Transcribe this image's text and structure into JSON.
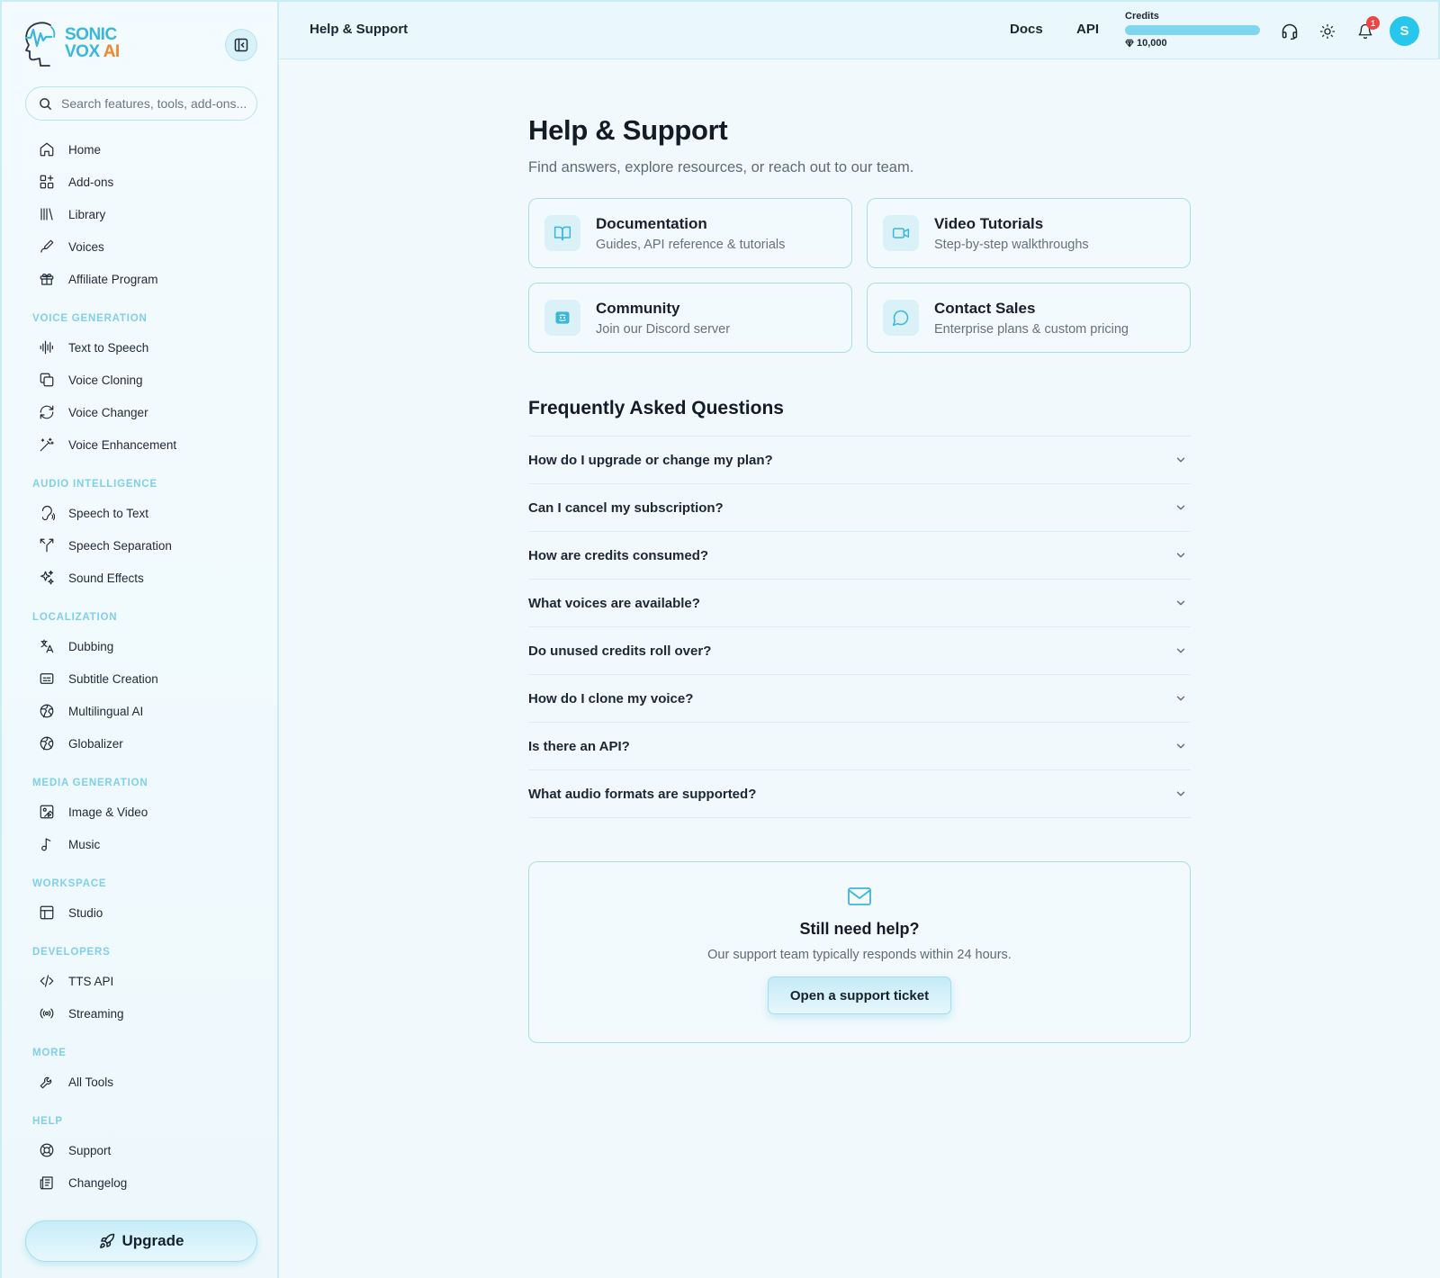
{
  "brand": {
    "line1": "SONIC",
    "line2_a": "VOX",
    "line2_b": "AI"
  },
  "search": {
    "placeholder": "Search features, tools, add-ons..."
  },
  "sidebar": {
    "top_items": [
      {
        "label": "Home",
        "icon": "home-icon"
      },
      {
        "label": "Add-ons",
        "icon": "addons-icon"
      },
      {
        "label": "Library",
        "icon": "library-icon"
      },
      {
        "label": "Voices",
        "icon": "voices-icon"
      },
      {
        "label": "Affiliate Program",
        "icon": "gift-icon"
      }
    ],
    "sections": [
      {
        "title": "VOICE GENERATION",
        "items": [
          {
            "label": "Text to Speech",
            "icon": "waveform-icon"
          },
          {
            "label": "Voice Cloning",
            "icon": "copy-icon"
          },
          {
            "label": "Voice Changer",
            "icon": "refresh-icon"
          },
          {
            "label": "Voice Enhancement",
            "icon": "magic-wand-icon"
          }
        ]
      },
      {
        "title": "AUDIO INTELLIGENCE",
        "items": [
          {
            "label": "Speech to Text",
            "icon": "ear-icon"
          },
          {
            "label": "Speech Separation",
            "icon": "split-icon"
          },
          {
            "label": "Sound Effects",
            "icon": "sparkles-icon"
          }
        ]
      },
      {
        "title": "LOCALIZATION",
        "items": [
          {
            "label": "Dubbing",
            "icon": "translate-icon"
          },
          {
            "label": "Subtitle Creation",
            "icon": "captions-icon"
          },
          {
            "label": "Multilingual AI",
            "icon": "globe-icon"
          },
          {
            "label": "Globalizer",
            "icon": "globe-icon"
          }
        ]
      },
      {
        "title": "MEDIA GENERATION",
        "items": [
          {
            "label": "Image & Video",
            "icon": "image-video-icon"
          },
          {
            "label": "Music",
            "icon": "music-note-icon"
          }
        ]
      },
      {
        "title": "WORKSPACE",
        "items": [
          {
            "label": "Studio",
            "icon": "layout-icon"
          }
        ]
      },
      {
        "title": "DEVELOPERS",
        "items": [
          {
            "label": "TTS API",
            "icon": "code-icon"
          },
          {
            "label": "Streaming",
            "icon": "broadcast-icon"
          }
        ]
      },
      {
        "title": "MORE",
        "items": [
          {
            "label": "All Tools",
            "icon": "wrench-icon"
          }
        ]
      },
      {
        "title": "HELP",
        "items": [
          {
            "label": "Support",
            "icon": "lifebuoy-icon"
          },
          {
            "label": "Changelog",
            "icon": "newspaper-icon"
          }
        ]
      }
    ],
    "upgrade_label": "Upgrade"
  },
  "header": {
    "title": "Help & Support",
    "docs_label": "Docs",
    "api_label": "API",
    "credits_label": "Credits",
    "credits_amount": "10,000",
    "credits_fill_percent": 100,
    "notification_count": "1",
    "avatar_initial": "S"
  },
  "main": {
    "title": "Help & Support",
    "subtitle": "Find answers, explore resources, or reach out to our team.",
    "cards": [
      {
        "title": "Documentation",
        "desc": "Guides, API reference & tutorials",
        "icon": "book-icon"
      },
      {
        "title": "Video Tutorials",
        "desc": "Step-by-step walkthroughs",
        "icon": "video-icon"
      },
      {
        "title": "Community",
        "desc": "Join our Discord server",
        "icon": "discord-icon"
      },
      {
        "title": "Contact Sales",
        "desc": "Enterprise plans & custom pricing",
        "icon": "chat-icon"
      }
    ],
    "faq_title": "Frequently Asked Questions",
    "faqs": [
      "How do I upgrade or change my plan?",
      "Can I cancel my subscription?",
      "How are credits consumed?",
      "What voices are available?",
      "Do unused credits roll over?",
      "How do I clone my voice?",
      "Is there an API?",
      "What audio formats are supported?"
    ],
    "help": {
      "title": "Still need help?",
      "desc": "Our support team typically responds within 24 hours.",
      "button": "Open a support ticket"
    }
  },
  "colors": {
    "accent": "#3bb6dc",
    "brand_orange": "#f2852b",
    "badge": "#ef4444",
    "avatar": "#27c6ec"
  }
}
